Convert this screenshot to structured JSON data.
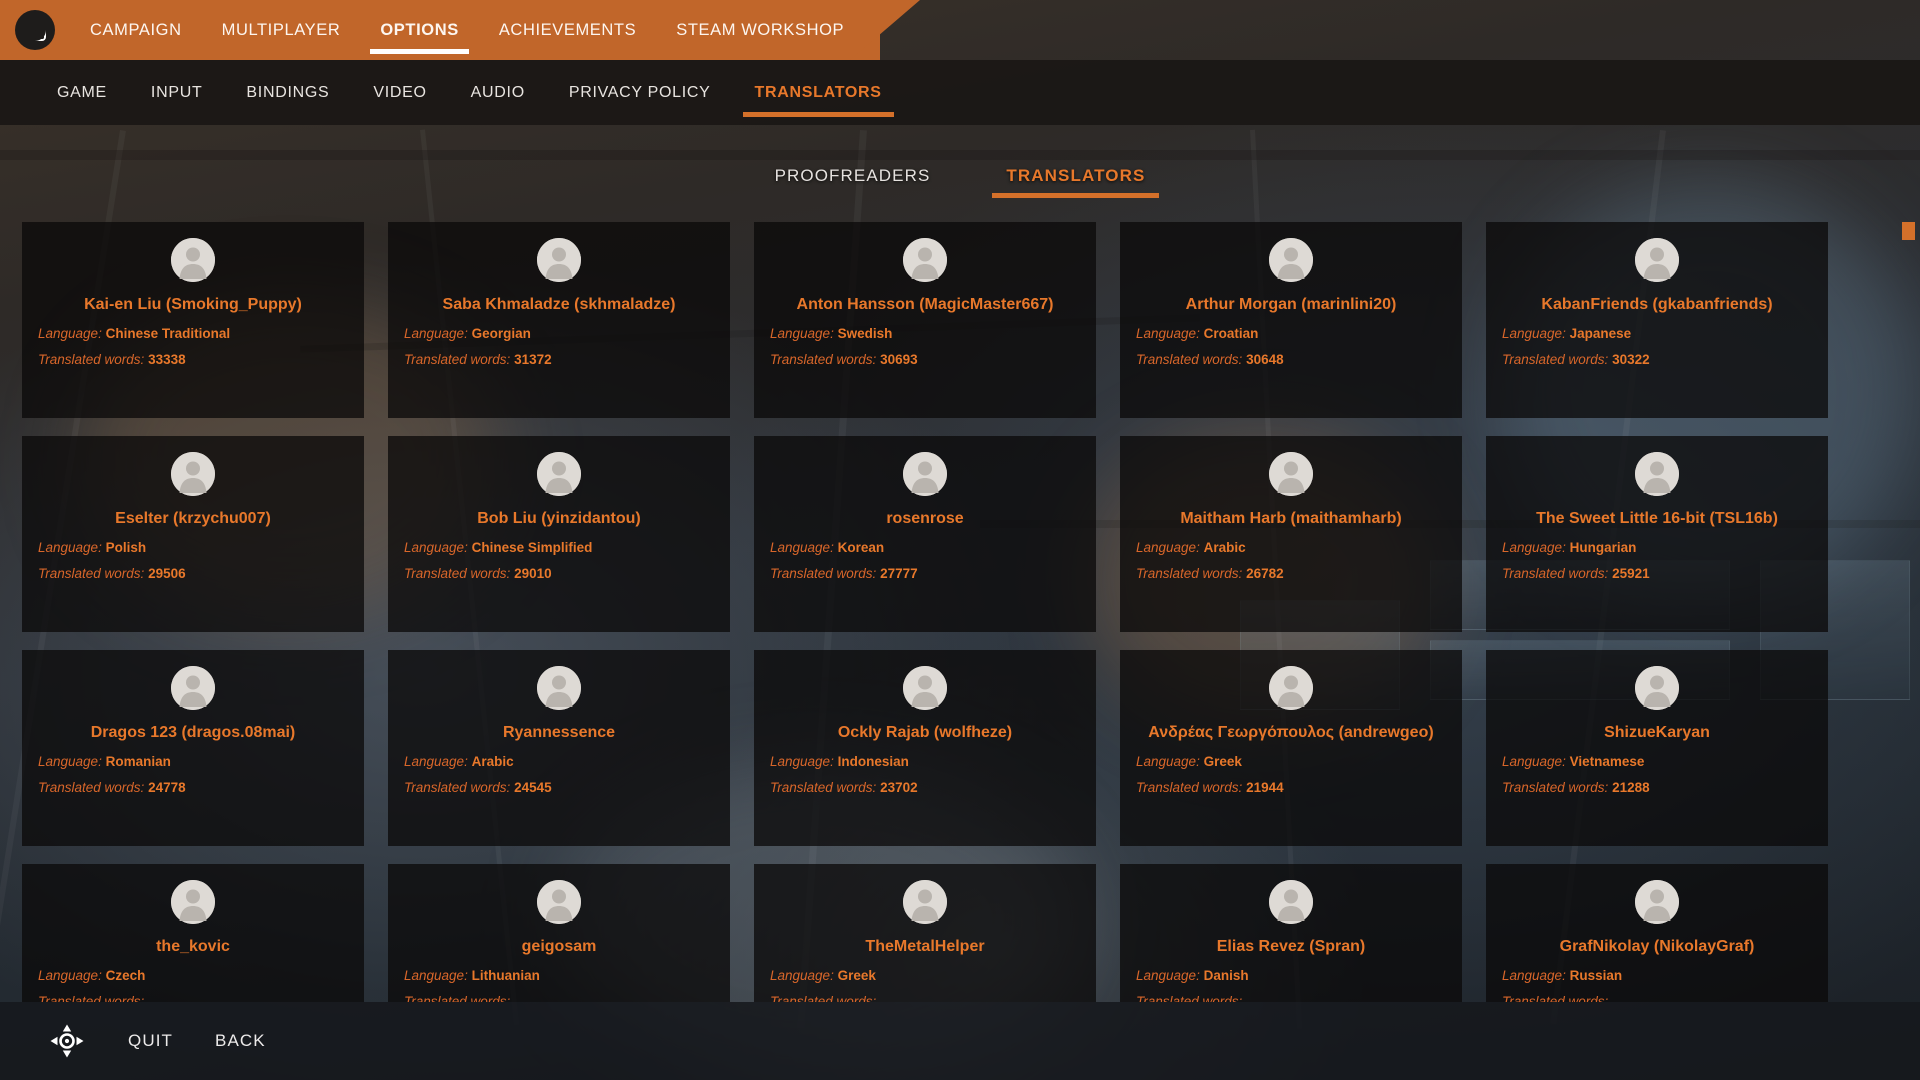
{
  "topnav": {
    "logo_icon": "game-logo-icon",
    "items": [
      {
        "label": "CAMPAIGN",
        "active": false
      },
      {
        "label": "MULTIPLAYER",
        "active": false
      },
      {
        "label": "OPTIONS",
        "active": true
      },
      {
        "label": "ACHIEVEMENTS",
        "active": false
      },
      {
        "label": "STEAM WORKSHOP",
        "active": false
      }
    ]
  },
  "subnav": {
    "items": [
      {
        "label": "GAME",
        "active": false
      },
      {
        "label": "INPUT",
        "active": false
      },
      {
        "label": "BINDINGS",
        "active": false
      },
      {
        "label": "VIDEO",
        "active": false
      },
      {
        "label": "AUDIO",
        "active": false
      },
      {
        "label": "PRIVACY POLICY",
        "active": false
      },
      {
        "label": "TRANSLATORS",
        "active": true
      }
    ]
  },
  "content_tabs": [
    {
      "label": "PROOFREADERS",
      "active": false
    },
    {
      "label": "TRANSLATORS",
      "active": true
    }
  ],
  "labels": {
    "language": "Language:",
    "translated_words": "Translated words:"
  },
  "colors": {
    "accent": "#e8782b",
    "accent_dark": "#c1662a",
    "underline": "#d4702a",
    "card_bg": "#0a0909",
    "text_light": "#e8e4e0"
  },
  "cards": [
    {
      "name": "Kai-en Liu (Smoking_Puppy)",
      "language": "Chinese Traditional",
      "words": "33338"
    },
    {
      "name": "Saba Khmaladze (skhmaladze)",
      "language": "Georgian",
      "words": "31372"
    },
    {
      "name": "Anton Hansson (MagicMaster667)",
      "language": "Swedish",
      "words": "30693"
    },
    {
      "name": "Arthur Morgan (marinlini20)",
      "language": "Croatian",
      "words": "30648"
    },
    {
      "name": "KabanFriends (gkabanfriends)",
      "language": "Japanese",
      "words": "30322"
    },
    {
      "name": "Eselter (krzychu007)",
      "language": "Polish",
      "words": "29506"
    },
    {
      "name": "Bob Liu (yinzidantou)",
      "language": "Chinese Simplified",
      "words": "29010"
    },
    {
      "name": "rosenrose",
      "language": "Korean",
      "words": "27777"
    },
    {
      "name": "Maitham Harb (maithamharb)",
      "language": "Arabic",
      "words": "26782"
    },
    {
      "name": "The Sweet Little 16-bit (TSL16b)",
      "language": "Hungarian",
      "words": "25921"
    },
    {
      "name": "Dragos 123 (dragos.08mai)",
      "language": "Romanian",
      "words": "24778"
    },
    {
      "name": "Ryannessence",
      "language": "Arabic",
      "words": "24545"
    },
    {
      "name": "Ockly Rajab (wolfheze)",
      "language": "Indonesian",
      "words": "23702"
    },
    {
      "name": "Ανδρέας Γεωργόπουλος (andrewgeo)",
      "language": "Greek",
      "words": "21944"
    },
    {
      "name": "ShizueKaryan",
      "language": "Vietnamese",
      "words": "21288"
    },
    {
      "name": "the_kovic",
      "language": "Czech",
      "words": ""
    },
    {
      "name": "geigosam",
      "language": "Lithuanian",
      "words": ""
    },
    {
      "name": "TheMetalHelper",
      "language": "Greek",
      "words": ""
    },
    {
      "name": "Elias Revez (Spran)",
      "language": "Danish",
      "words": ""
    },
    {
      "name": "GrafNikolay (NikolayGraf)",
      "language": "Russian",
      "words": ""
    }
  ],
  "scrollbar": {
    "thumb_position_pct": 0
  },
  "footer": {
    "navigate_icon": "dpad-navigate-icon",
    "buttons": [
      {
        "label": "QUIT"
      },
      {
        "label": "BACK"
      }
    ]
  }
}
